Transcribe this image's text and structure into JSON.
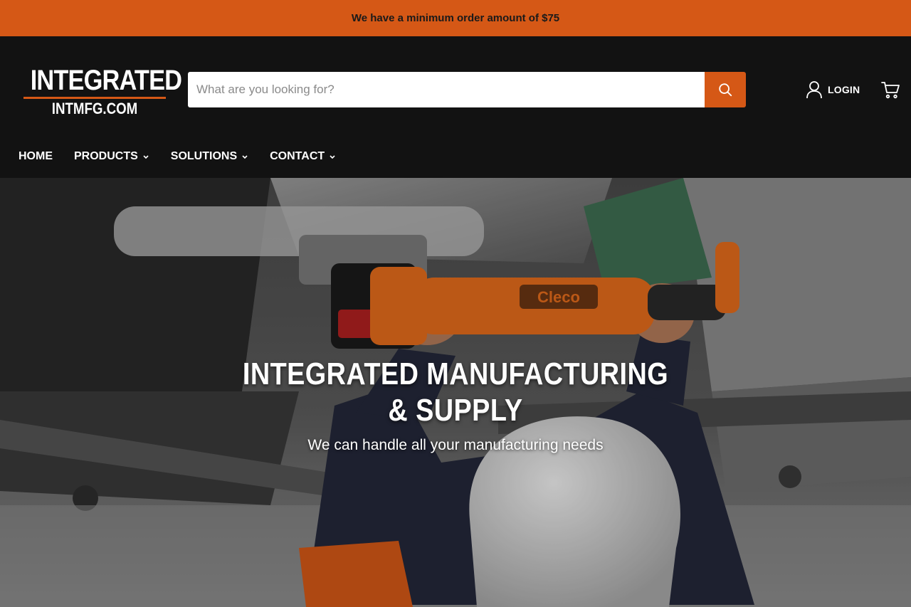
{
  "announcement": {
    "text": "We have a minimum order amount of $75"
  },
  "brand": {
    "name_top": "INTEGRATED",
    "name_bottom": "INTMFG.COM",
    "accent_color": "#d55816"
  },
  "search": {
    "placeholder": "What are you looking for?",
    "value": "",
    "icon": "search-icon"
  },
  "account": {
    "login_label": "LOGIN",
    "icon": "user-icon"
  },
  "cart": {
    "icon": "cart-icon"
  },
  "nav": {
    "items": [
      {
        "label": "HOME",
        "has_dropdown": false
      },
      {
        "label": "PRODUCTS",
        "has_dropdown": true
      },
      {
        "label": "SOLUTIONS",
        "has_dropdown": true
      },
      {
        "label": "CONTACT",
        "has_dropdown": true
      }
    ]
  },
  "hero": {
    "title": "INTEGRATED MANUFACTURING & SUPPLY",
    "subtitle": "We can handle all your manufacturing needs",
    "tool_brand": "Cleco"
  }
}
